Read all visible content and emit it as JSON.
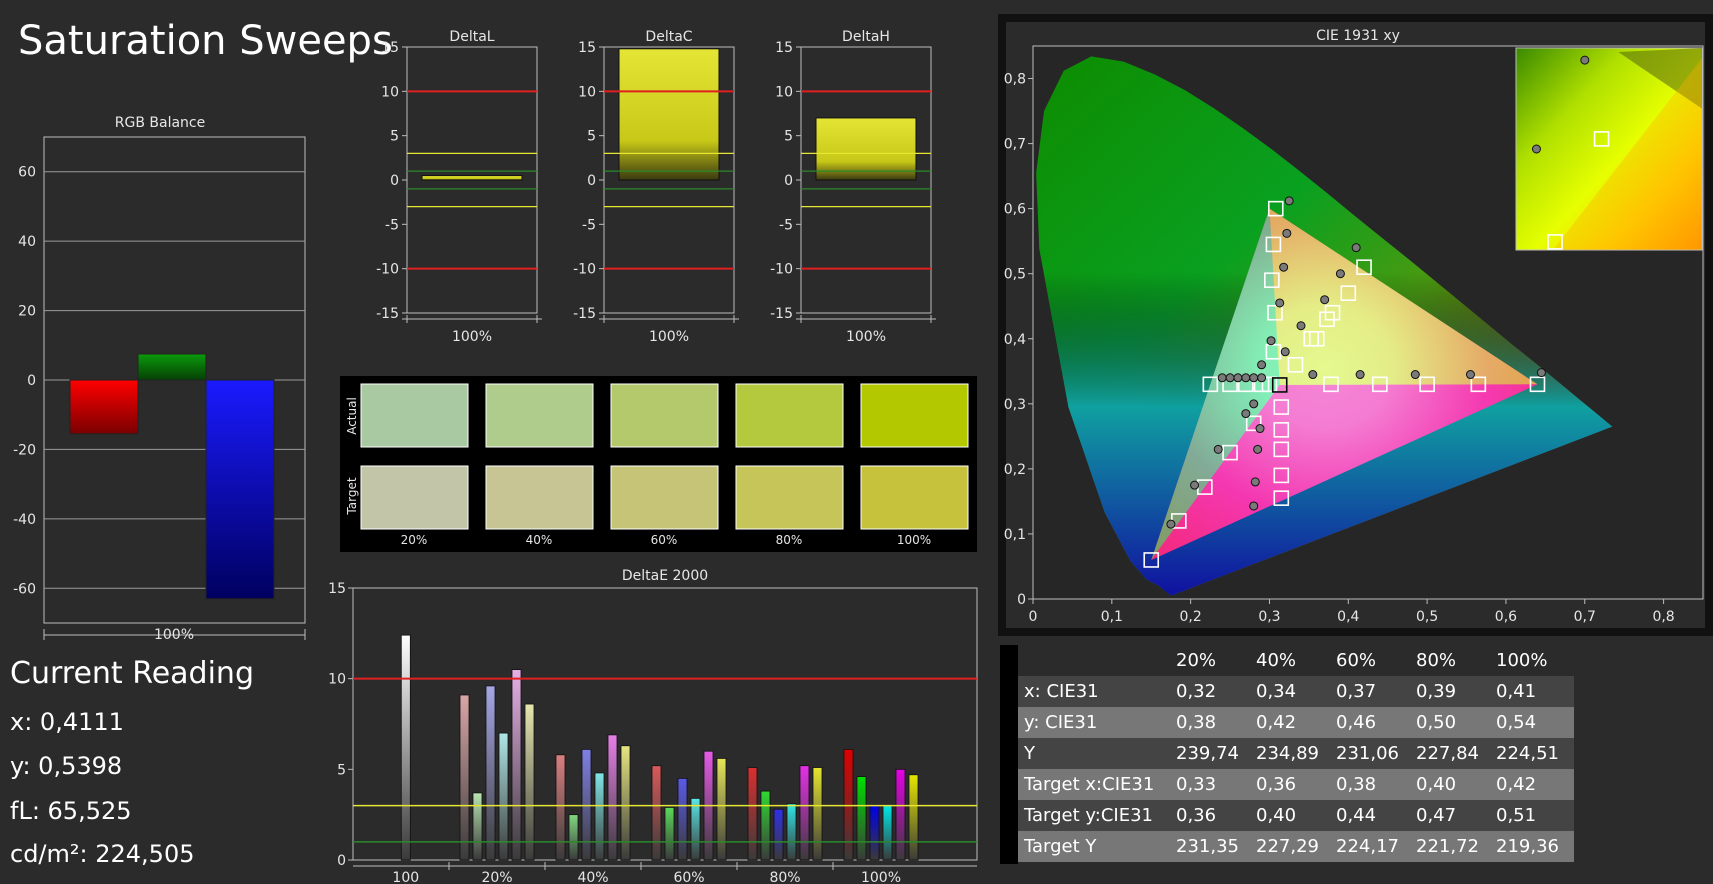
{
  "page_title": "Saturation Sweeps",
  "rgb_balance": {
    "title": "RGB Balance",
    "xlabel": "100%",
    "yticks": [
      "60",
      "40",
      "20",
      "0",
      "-20",
      "-40",
      "-60"
    ]
  },
  "delta_charts": [
    {
      "title": "DeltaL",
      "xlabel": "100%"
    },
    {
      "title": "DeltaC",
      "xlabel": "100%"
    },
    {
      "title": "DeltaH",
      "xlabel": "100%"
    }
  ],
  "delta_yticks": [
    "15",
    "10",
    "5",
    "0",
    "-5",
    "-10",
    "-15"
  ],
  "swatches": {
    "actual_label": "Actual",
    "target_label": "Target",
    "labels": [
      "20%",
      "40%",
      "60%",
      "80%",
      "100%"
    ],
    "actual_colors": [
      "#a9c9a3",
      "#b0cc8d",
      "#b4c96b",
      "#b4c93e",
      "#b4c800"
    ],
    "target_colors": [
      "#c3c5a9",
      "#c6c593",
      "#c6c577",
      "#c6c55a",
      "#c6c23c"
    ]
  },
  "deltae": {
    "title": "DeltaE 2000",
    "yticks": [
      "15",
      "10",
      "5",
      "0"
    ],
    "xlabels": [
      "100",
      "20%",
      "40%",
      "60%",
      "80%",
      "100%"
    ]
  },
  "cie": {
    "title": "CIE 1931 xy",
    "xticks": [
      "0",
      "0,1",
      "0,2",
      "0,3",
      "0,4",
      "0,5",
      "0,6",
      "0,7",
      "0,8"
    ],
    "yticks": [
      "0",
      "0,1",
      "0,2",
      "0,3",
      "0,4",
      "0,5",
      "0,6",
      "0,7",
      "0,8"
    ]
  },
  "current_reading": {
    "title": "Current Reading",
    "x": "x: 0,4111",
    "y": "y: 0,5398",
    "fl": "fL: 65,525",
    "cd": "cd/m²: 224,505"
  },
  "table": {
    "headers": [
      "",
      "20%",
      "40%",
      "60%",
      "80%",
      "100%"
    ],
    "rows": [
      [
        "x: CIE31",
        "0,32",
        "0,34",
        "0,37",
        "0,39",
        "0,41"
      ],
      [
        "y: CIE31",
        "0,38",
        "0,42",
        "0,46",
        "0,50",
        "0,54"
      ],
      [
        "Y",
        "239,74",
        "234,89",
        "231,06",
        "227,84",
        "224,51"
      ],
      [
        "Target x:CIE31",
        "0,33",
        "0,36",
        "0,38",
        "0,40",
        "0,42"
      ],
      [
        "Target y:CIE31",
        "0,36",
        "0,40",
        "0,44",
        "0,47",
        "0,51"
      ],
      [
        "Target Y",
        "231,35",
        "227,29",
        "224,17",
        "221,72",
        "219,36"
      ]
    ]
  },
  "chart_data": [
    {
      "type": "bar",
      "title": "RGB Balance",
      "categories": [
        "100%"
      ],
      "series": [
        {
          "name": "Red",
          "values": [
            -15.5
          ],
          "color": "#ff0000"
        },
        {
          "name": "Green",
          "values": [
            7.5
          ],
          "color": "#0a8a0a"
        },
        {
          "name": "Blue",
          "values": [
            -63
          ],
          "color": "#1010ff"
        }
      ],
      "ylim": [
        -70,
        70
      ],
      "yticks": [
        60,
        40,
        20,
        0,
        -20,
        -40,
        -60
      ],
      "grid": true
    },
    {
      "type": "bar",
      "title": "DeltaL",
      "categories": [
        "100%"
      ],
      "values": [
        0.5
      ],
      "ylim": [
        -15,
        15
      ],
      "reference_lines": [
        10,
        -10,
        3,
        -3,
        1,
        -1
      ]
    },
    {
      "type": "bar",
      "title": "DeltaC",
      "categories": [
        "100%"
      ],
      "values": [
        14.8
      ],
      "ylim": [
        -15,
        15
      ],
      "reference_lines": [
        10,
        -10,
        3,
        -3,
        1,
        -1
      ]
    },
    {
      "type": "bar",
      "title": "DeltaH",
      "categories": [
        "100%"
      ],
      "values": [
        7
      ],
      "ylim": [
        -15,
        15
      ],
      "reference_lines": [
        10,
        -10,
        3,
        -3,
        1,
        -1
      ]
    },
    {
      "type": "bar",
      "title": "DeltaE 2000",
      "categories": [
        "100",
        "20%",
        "40%",
        "60%",
        "80%",
        "100%"
      ],
      "groups": [
        {
          "label": "100",
          "values": [
            12.4
          ],
          "colors": [
            "#ffffff"
          ]
        },
        {
          "label": "20%",
          "values": [
            9.1,
            3.7,
            9.6,
            7.0,
            10.5,
            8.6
          ],
          "colors": [
            "#d9a6a6",
            "#b8e6b0",
            "#a6a6e6",
            "#b0e6e6",
            "#e6b0e6",
            "#e6e6b0"
          ]
        },
        {
          "label": "40%",
          "values": [
            5.8,
            2.5,
            6.1,
            4.8,
            6.9,
            6.3
          ],
          "colors": [
            "#d98080",
            "#80d980",
            "#8080e6",
            "#80e6e6",
            "#e680e6",
            "#e6e680"
          ]
        },
        {
          "label": "60%",
          "values": [
            5.2,
            2.9,
            4.5,
            3.4,
            6.0,
            5.6
          ],
          "colors": [
            "#d95a5a",
            "#5ad95a",
            "#5a5ae6",
            "#5ae6e6",
            "#e65ae6",
            "#e6e65a"
          ]
        },
        {
          "label": "80%",
          "values": [
            5.1,
            3.8,
            2.8,
            3.1,
            5.2,
            5.1
          ],
          "colors": [
            "#d93030",
            "#30d930",
            "#3030e6",
            "#30e6e6",
            "#e630e6",
            "#e6e630"
          ]
        },
        {
          "label": "100%",
          "values": [
            6.1,
            4.6,
            3.0,
            3.0,
            5.0,
            4.7
          ],
          "colors": [
            "#e00000",
            "#00e000",
            "#0000e6",
            "#00e6e6",
            "#e600e6",
            "#e6e600"
          ]
        }
      ],
      "ylim": [
        0,
        15
      ],
      "reference_lines": [
        10,
        3,
        1
      ]
    },
    {
      "type": "scatter",
      "title": "CIE 1931 xy",
      "xlim": [
        0,
        0.85
      ],
      "ylim": [
        0,
        0.85
      ],
      "targets": [
        [
          0.313,
          0.329
        ],
        [
          0.333,
          0.36
        ],
        [
          0.36,
          0.4
        ],
        [
          0.38,
          0.44
        ],
        [
          0.4,
          0.47
        ],
        [
          0.42,
          0.51
        ],
        [
          0.308,
          0.6
        ],
        [
          0.305,
          0.545
        ],
        [
          0.303,
          0.49
        ],
        [
          0.307,
          0.44
        ],
        [
          0.305,
          0.38
        ],
        [
          0.353,
          0.4
        ],
        [
          0.373,
          0.43
        ],
        [
          0.5,
          0.33
        ],
        [
          0.565,
          0.33
        ],
        [
          0.64,
          0.33
        ],
        [
          0.44,
          0.33
        ],
        [
          0.378,
          0.33
        ],
        [
          0.15,
          0.06
        ],
        [
          0.185,
          0.12
        ],
        [
          0.218,
          0.172
        ],
        [
          0.25,
          0.225
        ],
        [
          0.28,
          0.27
        ],
        [
          0.315,
          0.155
        ],
        [
          0.315,
          0.19
        ],
        [
          0.315,
          0.23
        ],
        [
          0.315,
          0.26
        ],
        [
          0.315,
          0.295
        ],
        [
          0.225,
          0.33
        ],
        [
          0.25,
          0.33
        ],
        [
          0.27,
          0.33
        ],
        [
          0.29,
          0.33
        ],
        [
          0.3,
          0.33
        ]
      ],
      "measured": [
        [
          0.32,
          0.38
        ],
        [
          0.34,
          0.42
        ],
        [
          0.37,
          0.46
        ],
        [
          0.39,
          0.5
        ],
        [
          0.41,
          0.54
        ],
        [
          0.325,
          0.612
        ],
        [
          0.322,
          0.562
        ],
        [
          0.318,
          0.51
        ],
        [
          0.313,
          0.455
        ],
        [
          0.302,
          0.397
        ],
        [
          0.29,
          0.36
        ],
        [
          0.355,
          0.345
        ],
        [
          0.415,
          0.345
        ],
        [
          0.485,
          0.345
        ],
        [
          0.555,
          0.345
        ],
        [
          0.645,
          0.348
        ],
        [
          0.175,
          0.115
        ],
        [
          0.205,
          0.175
        ],
        [
          0.235,
          0.23
        ],
        [
          0.27,
          0.285
        ],
        [
          0.29,
          0.34
        ],
        [
          0.28,
          0.143
        ],
        [
          0.282,
          0.18
        ],
        [
          0.285,
          0.23
        ],
        [
          0.288,
          0.262
        ],
        [
          0.28,
          0.3
        ],
        [
          0.24,
          0.34
        ],
        [
          0.25,
          0.34
        ],
        [
          0.26,
          0.34
        ],
        [
          0.27,
          0.34
        ],
        [
          0.28,
          0.34
        ]
      ],
      "inset_measured": [
        [
          0.41,
          0.54
        ],
        [
          0.385,
          0.5
        ]
      ]
    }
  ]
}
